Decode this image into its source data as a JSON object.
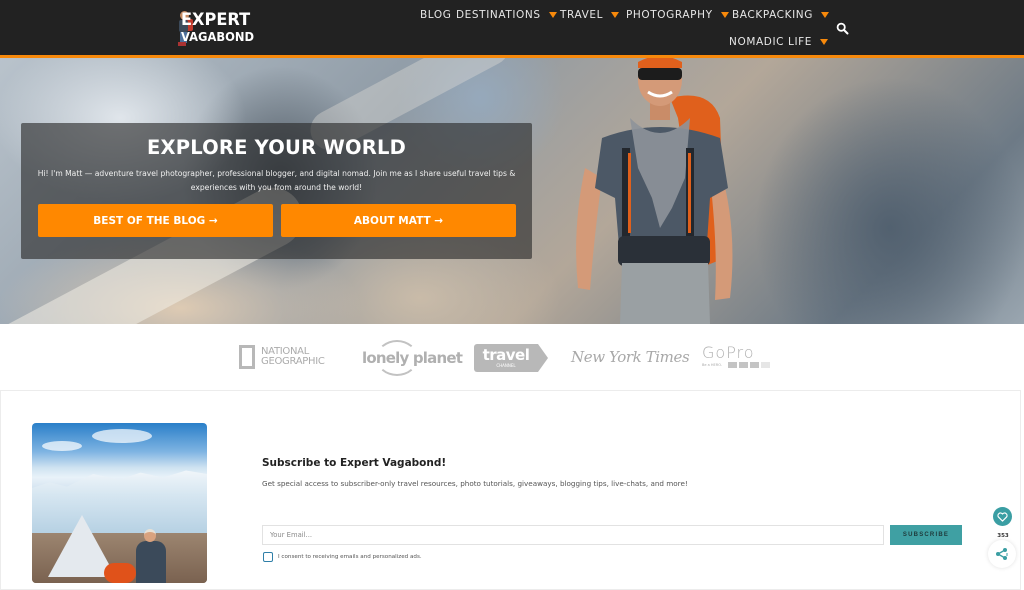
{
  "site": {
    "logo_line1": "EXPERT",
    "logo_line2": "VAGABOND"
  },
  "nav": {
    "items": [
      {
        "label": "BLOG",
        "has_dropdown": false
      },
      {
        "label": "DESTINATIONS",
        "has_dropdown": true
      },
      {
        "label": "TRAVEL",
        "has_dropdown": true
      },
      {
        "label": "PHOTOGRAPHY",
        "has_dropdown": true
      },
      {
        "label": "BACKPACKING",
        "has_dropdown": true
      },
      {
        "label": "NOMADIC LIFE",
        "has_dropdown": true
      }
    ],
    "search_icon": "search-icon"
  },
  "hero": {
    "title": "EXPLORE YOUR WORLD",
    "text": "Hi! I'm Matt — adventure travel photographer, professional blogger, and digital nomad. Join me as I share useful travel tips & experiences with you from around the world!",
    "buttons": [
      {
        "label": "BEST OF THE BLOG →"
      },
      {
        "label": "ABOUT MATT →"
      }
    ]
  },
  "press": {
    "logos": [
      {
        "name": "National Geographic",
        "line1": "NATIONAL",
        "line2": "GEOGRAPHIC"
      },
      {
        "name": "Lonely Planet",
        "text": "lonely planet"
      },
      {
        "name": "Travel Channel",
        "text": "travel",
        "sub": "CHANNEL"
      },
      {
        "name": "New York Times",
        "text": "New York Times"
      },
      {
        "name": "GoPro",
        "text": "GoPro",
        "sub": "Be a HERO."
      }
    ]
  },
  "subscribe": {
    "title": "Subscribe to Expert Vagabond!",
    "description": "Get special access to subscriber-only travel resources, photo tutorials, giveaways, blogging tips, live-chats, and more!",
    "email_placeholder": "Your Email...",
    "email_value": "",
    "button_label": "SUBSCRIBE",
    "consent_label": "I consent to receiving emails and personalized ads.",
    "consent_checked": false
  },
  "share": {
    "count": "353"
  },
  "colors": {
    "accent": "#f7890b",
    "button": "#ff8800",
    "header_bg": "#222222",
    "subscribe_btn": "#3fa0a3"
  }
}
